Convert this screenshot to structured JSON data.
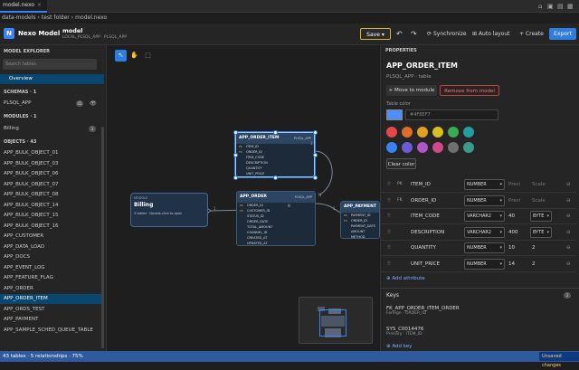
{
  "tab": {
    "label": "model.nexo",
    "close": "×"
  },
  "window_icons": [
    "home-icon",
    "lock-icon",
    "save-icon",
    "grid-icon"
  ],
  "breadcrumb": [
    "data-models",
    "›",
    "test folder",
    "›",
    "model.nexo"
  ],
  "toolbar": {
    "app_name": "Nexo Model",
    "model_name": "model",
    "model_sub": "LOCAL_PLSQL_APP · PLSQL_APP",
    "save": "Save",
    "undo": "↶",
    "redo": "↷",
    "synchronize": "Synchronize",
    "auto_layout": "Auto layout",
    "create": "+ Create",
    "export": "Export"
  },
  "sidebar": {
    "model_explorer": "MODEL EXPLORER",
    "search_placeholder": "Search tables",
    "overview": "Overview",
    "schemas_head": "SCHEMAS · 1",
    "schema": {
      "name": "PLSQL_APP",
      "count": "41"
    },
    "modules_head": "MODULES · 1",
    "module": {
      "name": "Billing",
      "count": "3"
    },
    "objects_head": "OBJECTS · 43",
    "objects": [
      "APP_BULK_OBJECT_01",
      "APP_BULK_OBJECT_03",
      "APP_BULK_OBJECT_06",
      "APP_BULK_OBJECT_07",
      "APP_BULK_OBJECT_08",
      "APP_BULK_OBJECT_14",
      "APP_BULK_OBJECT_15",
      "APP_BULK_OBJECT_16",
      "APP_CUSTOMER",
      "APP_DATA_LOAD",
      "APP_DOCS",
      "APP_EVENT_LOG",
      "APP_FEATURE_FLAG",
      "APP_ORDER",
      "APP_ORDER_ITEM",
      "APP_ORDS_TEST",
      "APP_PAYMENT",
      "APP_SAMPLE_SCHED_QUEUE_TABLE"
    ],
    "selected_index": 14
  },
  "canvas": {
    "tools": [
      "↖",
      "✋",
      "⬚"
    ],
    "order_item": {
      "title": "APP_ORDER_ITEM",
      "tag": "PLSQL_APP",
      "rows": [
        {
          "k": "PK",
          "n": "ITEM_ID"
        },
        {
          "k": "FK",
          "n": "ORDER_ID"
        },
        {
          "k": "",
          "n": "ITEM_CODE"
        },
        {
          "k": "",
          "n": "DESCRIPTION"
        },
        {
          "k": "",
          "n": "QUANTITY"
        },
        {
          "k": "",
          "n": "UNIT_PRICE"
        }
      ]
    },
    "order": {
      "title": "APP_ORDER",
      "tag": "PLSQL_APP",
      "rows": [
        {
          "k": "PK",
          "n": "ORDER_ID"
        },
        {
          "k": "FK",
          "n": "CUSTOMER_ID"
        },
        {
          "k": "",
          "n": "STATUS_ID"
        },
        {
          "k": "",
          "n": "ORDER_DATE"
        },
        {
          "k": "",
          "n": "TOTAL_AMOUNT"
        },
        {
          "k": "",
          "n": "CHANNEL_ID"
        },
        {
          "k": "",
          "n": "CREATED_AT"
        },
        {
          "k": "",
          "n": "UPDATED_AT"
        }
      ]
    },
    "payment": {
      "title": "APP_PAYMENT",
      "tag": "",
      "rows": [
        {
          "k": "PK",
          "n": "PAYMENT_ID"
        },
        {
          "k": "FK",
          "n": "ORDER_ID"
        },
        {
          "k": "",
          "n": "PAYMENT_DATE"
        },
        {
          "k": "",
          "n": "AMOUNT"
        },
        {
          "k": "",
          "n": "METHOD"
        }
      ]
    },
    "module": {
      "tag": "MODULE",
      "title": "Billing",
      "desc": "3 tables · Double-click to open"
    },
    "rel_labels": [
      "1",
      "N",
      "1",
      "N",
      "1"
    ]
  },
  "props": {
    "head": "PROPERTIES",
    "title": "APP_ORDER_ITEM",
    "sub": "PLSQL_APP · table",
    "move": "+ Move to module",
    "remove": "Remove from model",
    "color_label": "Table color",
    "hex": "#4F8EF7",
    "clear": "Clear color",
    "swatches": [
      "#e54848",
      "#e06c2c",
      "#e0a020",
      "#d8c020",
      "#3aaa55",
      "#20a0a0",
      "#3b82f6",
      "#6b5cd6",
      "#b054c8",
      "#d04888",
      "#707070",
      "#3c9a8c"
    ],
    "fields": [
      {
        "k": "PK",
        "name": "ITEM_ID",
        "type": "NUMBER",
        "p1": "Preci",
        "p2": "Scale"
      },
      {
        "k": "FK",
        "name": "ORDER_ID",
        "type": "NUMBER",
        "p1": "Preci",
        "p2": "Scale"
      },
      {
        "k": "",
        "name": "ITEM_CODE",
        "type": "VARCHAR2",
        "p1": "40",
        "p2": "BYTE"
      },
      {
        "k": "",
        "name": "DESCRIPTION",
        "type": "VARCHAR2",
        "p1": "400",
        "p2": "BYTE"
      },
      {
        "k": "",
        "name": "QUANTITY",
        "type": "NUMBER",
        "p1": "10",
        "p2": "2"
      },
      {
        "k": "",
        "name": "UNIT_PRICE",
        "type": "NUMBER",
        "p1": "14",
        "p2": "2"
      }
    ],
    "add_attr": "Add attribute",
    "keys_head": "Keys",
    "keys_count": "2",
    "keys": [
      {
        "name": "FK_APP_ORDER_ITEM_ORDER",
        "desc": "Foreign · ORDER_ID"
      },
      {
        "name": "SYS_C0014476",
        "desc": "Primary · ITEM_ID"
      }
    ],
    "add_key": "Add key"
  },
  "status": {
    "left": "43 tables · 5 relationships · 75%",
    "right": "Unsaved changes"
  },
  "colors": {
    "accent": "#3b82f6",
    "status": "#2f5b9e",
    "save_border": "#e0b030",
    "unsaved": "#0e3a80"
  }
}
